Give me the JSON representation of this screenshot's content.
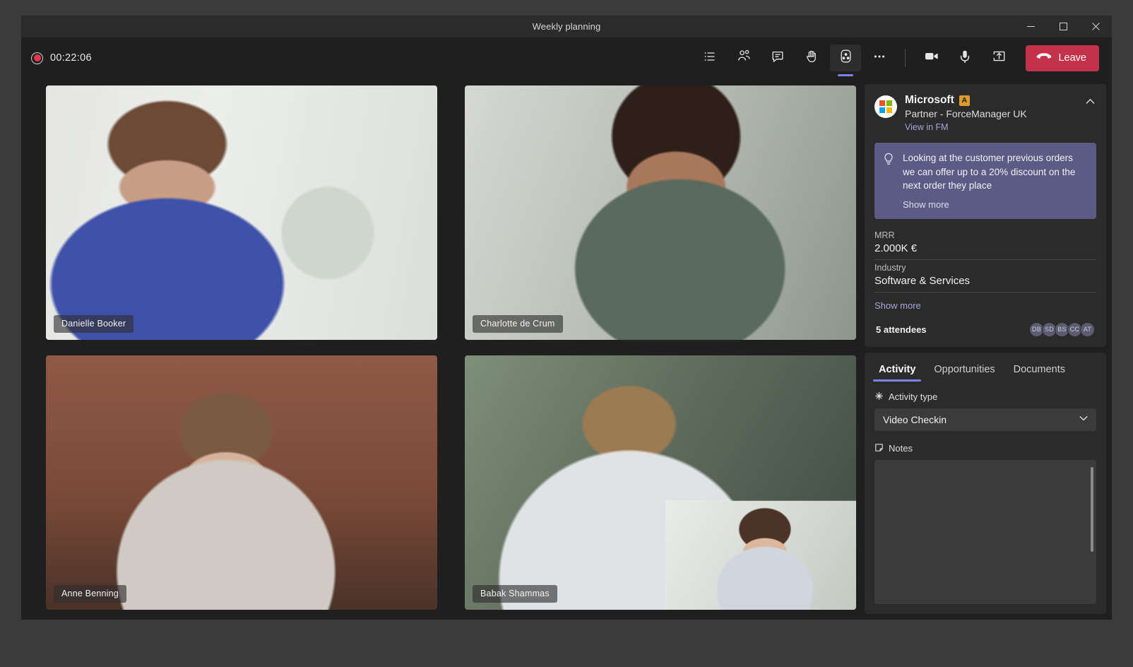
{
  "window": {
    "title": "Weekly planning",
    "controls": {
      "minimize": "minimize-icon",
      "maximize": "maximize-icon",
      "close": "close-icon"
    }
  },
  "meeting_bar": {
    "recording_timer": "00:22:06",
    "recording_icon": "record-dot-icon",
    "actions": [
      {
        "name": "meeting-notes-button",
        "icon": "list-icon",
        "label": "Meeting notes",
        "active": false
      },
      {
        "name": "show-participants-button",
        "icon": "people-icon",
        "label": "People",
        "active": false
      },
      {
        "name": "show-conversation-button",
        "icon": "chat-icon",
        "label": "Chat",
        "active": false
      },
      {
        "name": "raise-hand-button",
        "icon": "hand-icon",
        "label": "Raise hand",
        "active": false
      },
      {
        "name": "forcemanager-app-button",
        "icon": "app-contact-icon",
        "label": "ForceManager",
        "active": true
      },
      {
        "name": "more-actions-button",
        "icon": "ellipsis-icon",
        "label": "More actions",
        "active": false
      },
      {
        "name": "toggle-camera-button",
        "icon": "camera-icon",
        "label": "Camera",
        "active": false
      },
      {
        "name": "toggle-mic-button",
        "icon": "microphone-icon",
        "label": "Mic",
        "active": false
      },
      {
        "name": "share-screen-button",
        "icon": "share-screen-icon",
        "label": "Share",
        "active": false
      }
    ],
    "leave_label": "Leave",
    "leave_icon": "hangup-icon",
    "leave_color": "#c4314b"
  },
  "video_grid": {
    "participants": [
      {
        "name": "Danielle Booker"
      },
      {
        "name": "Charlotte de Crum"
      },
      {
        "name": "Anne Benning"
      },
      {
        "name": "Babak Shammas"
      }
    ]
  },
  "side_panel": {
    "account": {
      "logo": "microsoft-logo-icon",
      "name": "Microsoft",
      "badge": "A",
      "badge_color": "#e09b2d",
      "subtitle": "Partner - ForceManager UK",
      "link": "View in FM",
      "collapse_icon": "chevron-up-icon"
    },
    "suggestion": {
      "icon": "lightbulb-icon",
      "text": "Looking at the customer previous orders we can offer up to a 20% discount on the next order they place",
      "show_more": "Show more",
      "background": "#5b5b85"
    },
    "fields": [
      {
        "label": "MRR",
        "value": "2.000K €"
      },
      {
        "label": "Industry",
        "value": "Software & Services"
      }
    ],
    "fields_show_more": "Show more",
    "attendees": {
      "label": "5 attendees",
      "avatars": [
        "DB",
        "SD",
        "BS",
        "CC",
        "AT"
      ]
    },
    "tabs": [
      {
        "label": "Activity",
        "active": true
      },
      {
        "label": "Opportunities",
        "active": false
      },
      {
        "label": "Documents",
        "active": false
      }
    ],
    "activity": {
      "type_label": "Activity type",
      "type_icon": "sparkle-icon",
      "type_value": "Video Checkin",
      "type_chevron": "chevron-down-icon",
      "notes_label": "Notes",
      "notes_icon": "note-icon",
      "notes_value": "",
      "notes_placeholder": ""
    },
    "accent_color": "#7b83eb"
  }
}
